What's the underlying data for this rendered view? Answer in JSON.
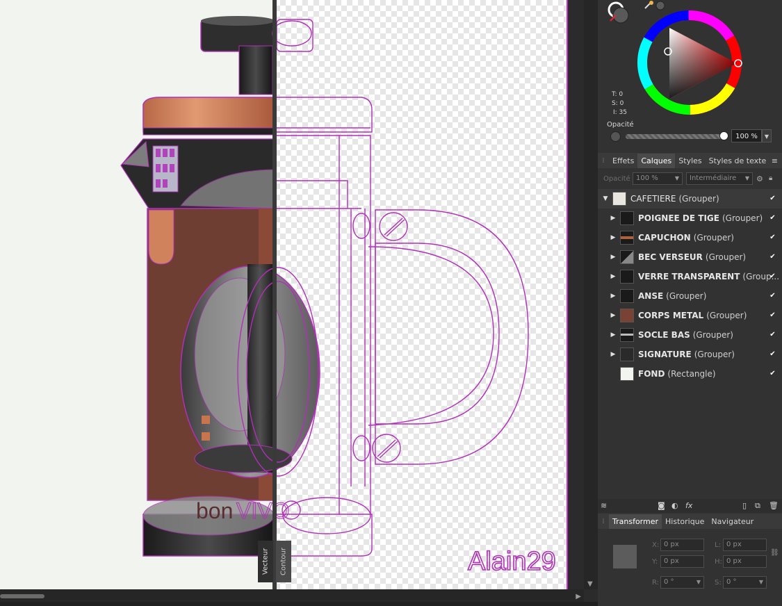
{
  "canvas": {
    "split_left_label": "Vecteur",
    "split_right_label": "Contour",
    "artwork": {
      "brand_bon": "bon",
      "brand_vivo": "VIVO",
      "signature": "Alain29"
    }
  },
  "colors": {
    "accent_outline": "#b030b8",
    "copper": "#c8754f",
    "body_brown": "#6e3e32",
    "doc_edge": "#c02fc0"
  },
  "color_panel": {
    "hsl": {
      "t": "T: 0",
      "s": "S: 0",
      "l": "I: 35"
    },
    "opacity_label": "Opacité",
    "opacity_value": "100 %",
    "opacity_fraction": 1.0
  },
  "layer_tabs": {
    "tabs": [
      "Effets",
      "Calques",
      "Styles",
      "Styles de texte"
    ],
    "active": "Calques"
  },
  "layer_controls": {
    "opacity_label": "Opacité",
    "opacity_value": "100 %",
    "blend_mode": "Intermédiaire"
  },
  "layers": {
    "root": {
      "name": "CAFETIERE",
      "type": "(Grouper)"
    },
    "children": [
      {
        "name": "POIGNEE DE TIGE",
        "type": "(Grouper)"
      },
      {
        "name": "CAPUCHON",
        "type": "(Grouper)"
      },
      {
        "name": "BEC VERSEUR",
        "type": "(Grouper)"
      },
      {
        "name": "VERRE  TRANSPARENT",
        "type": "(Group..."
      },
      {
        "name": "ANSE",
        "type": "(Grouper)"
      },
      {
        "name": "CORPS METAL",
        "type": "(Grouper)"
      },
      {
        "name": "SOCLE BAS",
        "type": "(Grouper)"
      },
      {
        "name": "SIGNATURE",
        "type": "(Grouper)"
      },
      {
        "name": "FOND",
        "type": "(Rectangle)"
      }
    ]
  },
  "transform_tabs": {
    "tabs": [
      "Transformer",
      "Historique",
      "Navigateur"
    ],
    "active": "Transformer"
  },
  "transform": {
    "x_label": "X:",
    "x_value": "0 px",
    "y_label": "Y:",
    "y_value": "0 px",
    "l_label": "L:",
    "l_value": "0 px",
    "h_label": "H:",
    "h_value": "0 px",
    "r_label": "R:",
    "r_value": "0 °",
    "s_label": "S:",
    "s_value": "0 °"
  }
}
